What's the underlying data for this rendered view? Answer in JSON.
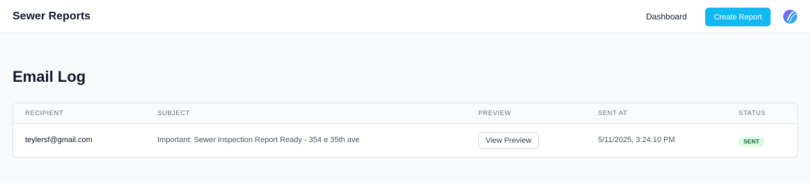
{
  "header": {
    "brand": "Sewer Reports",
    "nav_dashboard": "Dashboard",
    "create_report": "Create Report",
    "avatar_icon": "user-avatar-icon"
  },
  "page": {
    "title": "Email Log"
  },
  "table": {
    "columns": [
      "RECIPIENT",
      "SUBJECT",
      "PREVIEW",
      "SENT AT",
      "STATUS"
    ],
    "rows": [
      {
        "recipient": "teylersf@gmail.com",
        "subject": "Important: Sewer Inspection Report Ready - 354 e 35th ave",
        "preview": "View Preview",
        "sent_at": "5/11/2025, 3:24:10 PM",
        "status": "SENT"
      }
    ]
  },
  "colors": {
    "accent": "#12b8f0",
    "status_sent_bg": "#dcfce7",
    "status_sent_text": "#166534"
  }
}
